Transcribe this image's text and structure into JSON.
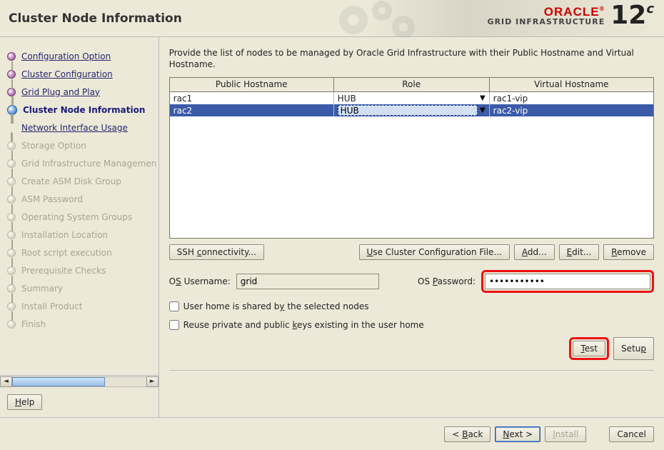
{
  "title": "Cluster Node Information",
  "brand": {
    "oracle": "ORACLE",
    "reg": "®",
    "product": "GRID INFRASTRUCTURE",
    "version_main": "12",
    "version_sup": "c"
  },
  "instruction": "Provide the list of nodes to be managed by Oracle Grid Infrastructure with their Public Hostname and Virtual Hostname.",
  "steps": [
    {
      "label": "Configuration Option",
      "state": "done",
      "link": true
    },
    {
      "label": "Cluster Configuration",
      "state": "done",
      "link": true
    },
    {
      "label": "Grid Plug and Play",
      "state": "done",
      "link": true
    },
    {
      "label": "Cluster Node Information",
      "state": "active",
      "link": false
    },
    {
      "label": "Network Interface Usage",
      "state": "avail",
      "link": true
    },
    {
      "label": "Storage Option",
      "state": "pending",
      "link": false
    },
    {
      "label": "Grid Infrastructure Managemen",
      "state": "pending",
      "link": false
    },
    {
      "label": "Create ASM Disk Group",
      "state": "pending",
      "link": false
    },
    {
      "label": "ASM Password",
      "state": "pending",
      "link": false
    },
    {
      "label": "Operating System Groups",
      "state": "pending",
      "link": false
    },
    {
      "label": "Installation Location",
      "state": "pending",
      "link": false
    },
    {
      "label": "Root script execution",
      "state": "pending",
      "link": false
    },
    {
      "label": "Prerequisite Checks",
      "state": "pending",
      "link": false
    },
    {
      "label": "Summary",
      "state": "pending",
      "link": false
    },
    {
      "label": "Install Product",
      "state": "pending",
      "link": false
    },
    {
      "label": "Finish",
      "state": "pending",
      "link": false
    }
  ],
  "grid": {
    "headers": {
      "host": "Public Hostname",
      "role": "Role",
      "vip": "Virtual Hostname"
    },
    "rows": [
      {
        "host": "rac1",
        "role": "HUB",
        "vip": "rac1-vip",
        "selected": false
      },
      {
        "host": "rac2",
        "role": "HUB",
        "vip": "rac2-vip",
        "selected": true
      }
    ]
  },
  "buttons": {
    "ssh": "SSH connectivity...",
    "use_config": "Use Cluster Configuration File...",
    "add": "Add...",
    "edit": "Edit...",
    "remove": "Remove",
    "test": "Test",
    "setup": "Setup",
    "help": "Help",
    "back": "< Back",
    "next": "Next >",
    "install": "Install",
    "cancel": "Cancel"
  },
  "labels": {
    "os_user": "OS Username:",
    "os_pass": "OS Password:",
    "chk_shared": "User home is shared by the selected nodes",
    "chk_reuse": "Reuse private and public keys existing in the user home"
  },
  "mnemonics": {
    "ssh": "c",
    "use_config": "U",
    "add": "A",
    "edit": "E",
    "remove": "R",
    "os_user": "S",
    "os_pass": "P",
    "chk_shared": "y",
    "chk_reuse": "k",
    "test": "T",
    "setup": "p",
    "help": "H",
    "back": "B",
    "next": "N",
    "install": "I"
  },
  "values": {
    "username": "grid",
    "password": "●●●●●●●●●●●"
  }
}
